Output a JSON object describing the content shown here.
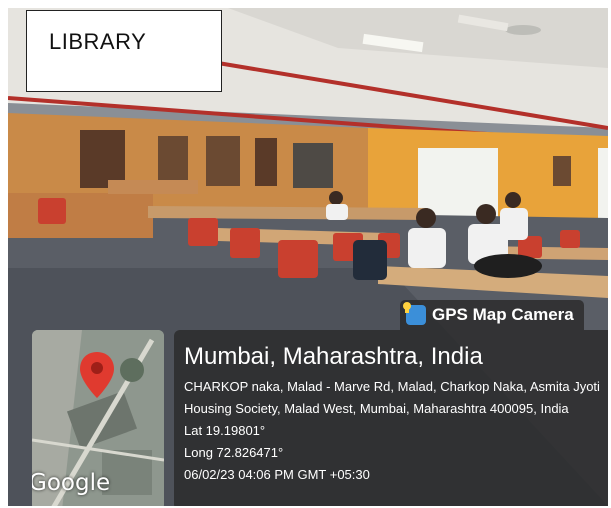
{
  "label": "LIBRARY",
  "overlay": {
    "brand": "GPS Map Camera",
    "map_attribution": "Google",
    "location_title": "Mumbai, Maharashtra, India",
    "address": "CHARKOP naka, Malad - Marve Rd, Malad, Charkop Naka, Asmita Jyoti Housing Society, Malad West, Mumbai, Maharashtra 400095, India",
    "latitude": "Lat 19.19801°",
    "longitude": "Long 72.826471°",
    "timestamp": "06/02/23 04:06 PM GMT +05:30"
  },
  "icons": {
    "brand_icon": "gps-camera-icon",
    "map_marker": "map-pin-icon"
  },
  "colors": {
    "pin_red": "#e03a2f",
    "wall_orange": "#e8a33a",
    "chair_red": "#c9402f",
    "overlay_bg": "#282828"
  }
}
